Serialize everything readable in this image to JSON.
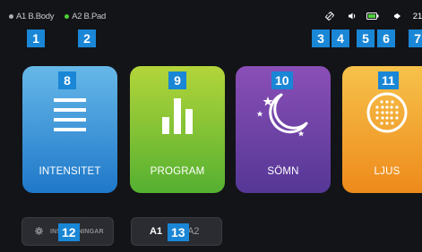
{
  "status": {
    "devices": [
      {
        "label": "A1 B.Body",
        "dot_color": "#b0b0b0"
      },
      {
        "label": "A2 B.Pad",
        "dot_color": "#4cd137"
      }
    ],
    "time": "21"
  },
  "badges": [
    "1",
    "2",
    "3",
    "4",
    "5",
    "6",
    "7",
    "8",
    "9",
    "10",
    "11",
    "12",
    "13"
  ],
  "cards": [
    {
      "label": "INTENSITET",
      "icon": "menu-lines-icon"
    },
    {
      "label": "PROGRAM",
      "icon": "bar-chart-icon"
    },
    {
      "label": "SÖMN",
      "icon": "moon-stars-icon"
    },
    {
      "label": "LJUS",
      "icon": "light-dots-icon"
    }
  ],
  "bottom": {
    "settings_label": "INSTÄLLNINGAR",
    "a1": "A1",
    "a2": "A2"
  },
  "colors": {
    "badge": "#1a86d6",
    "background": "#131417",
    "battery_green": "#4cd137"
  }
}
